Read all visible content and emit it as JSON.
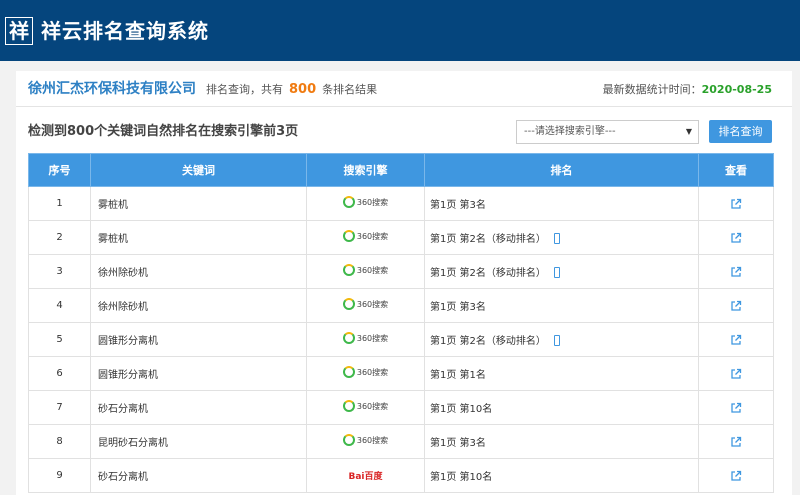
{
  "header": {
    "logo_char": "祥",
    "title": "祥云排名查询系统"
  },
  "info": {
    "company": "徐州汇杰环保科技有限公司",
    "count_prefix": "排名查询，共有",
    "count_value": "800",
    "count_suffix": "条排名结果",
    "stat_label": "最新数据统计时间：",
    "stat_date": "2020-08-25"
  },
  "summary": "检测到800个关键词自然排名在搜索引擎前3页",
  "search_engine_select": {
    "selected": "---请选择搜索引擎---"
  },
  "query_button": "排名查询",
  "table": {
    "headers": [
      "序号",
      "关键词",
      "搜索引擎",
      "排名",
      "查看"
    ],
    "rows": [
      {
        "no": "1",
        "keyword": "雾桩机",
        "engine": "360搜索",
        "rank": "第1页 第3名",
        "mobile": false
      },
      {
        "no": "2",
        "keyword": "雾桩机",
        "engine": "360搜索",
        "rank": "第1页 第2名（移动排名）",
        "mobile": true
      },
      {
        "no": "3",
        "keyword": "徐州除砂机",
        "engine": "360搜索",
        "rank": "第1页 第2名（移动排名）",
        "mobile": true
      },
      {
        "no": "4",
        "keyword": "徐州除砂机",
        "engine": "360搜索",
        "rank": "第1页 第3名",
        "mobile": false
      },
      {
        "no": "5",
        "keyword": "圆锥形分离机",
        "engine": "360搜索",
        "rank": "第1页 第2名（移动排名）",
        "mobile": true
      },
      {
        "no": "6",
        "keyword": "圆锥形分离机",
        "engine": "360搜索",
        "rank": "第1页 第1名",
        "mobile": false
      },
      {
        "no": "7",
        "keyword": "砂石分离机",
        "engine": "360搜索",
        "rank": "第1页 第10名",
        "mobile": false
      },
      {
        "no": "8",
        "keyword": "昆明砂石分离机",
        "engine": "360搜索",
        "rank": "第1页 第3名",
        "mobile": false
      },
      {
        "no": "9",
        "keyword": "砂石分离机",
        "engine": "百度",
        "engine_logo_text": "Bai百度",
        "rank": "第1页 第10名",
        "mobile": false
      }
    ]
  },
  "colors": {
    "topbar": "#05457d",
    "accent": "#3f97e0",
    "company": "#2d80c4",
    "count": "#f07b11",
    "date": "#2aa12b"
  }
}
